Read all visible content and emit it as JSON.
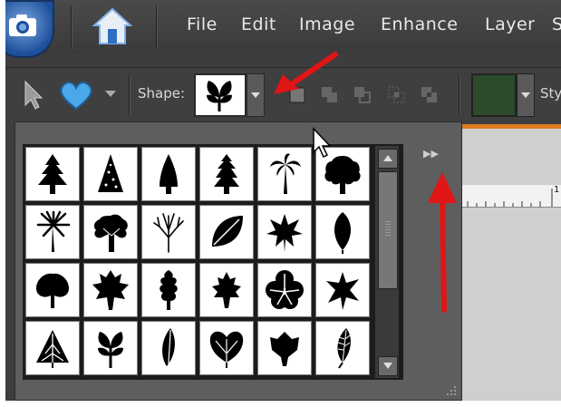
{
  "menu": {
    "items": [
      "File",
      "Edit",
      "Image",
      "Enhance",
      "Layer",
      "S"
    ]
  },
  "options": {
    "shape_label": "Shape:",
    "style_label": "Sty"
  },
  "colors": {
    "shape_fill": "#2c4a2c",
    "accent_orange": "#e07a1e",
    "annotation_red": "#e01515",
    "heart": "#4aa8e8"
  },
  "shapes": [
    [
      "tree-1",
      "tree-2",
      "tree-3",
      "tree-4",
      "palm-tree",
      "tree-round"
    ],
    [
      "palm-tree-2",
      "tree-bushy",
      "tree-bare",
      "leaf-oval",
      "leaf-maple-1",
      "leaf-pointed"
    ],
    [
      "leaf-wide",
      "leaf-maple-2",
      "leaf-oak",
      "leaf-maple-3",
      "leaf-clover",
      "leaf-star"
    ],
    [
      "leaf-triangle",
      "leaf-sprig",
      "leaf-narrow",
      "leaf-round",
      "leaf-ivy",
      "leaf-feather"
    ]
  ],
  "panel": {
    "menu_glyph": "▶▶"
  },
  "ruler": {
    "first_tick": "1"
  }
}
